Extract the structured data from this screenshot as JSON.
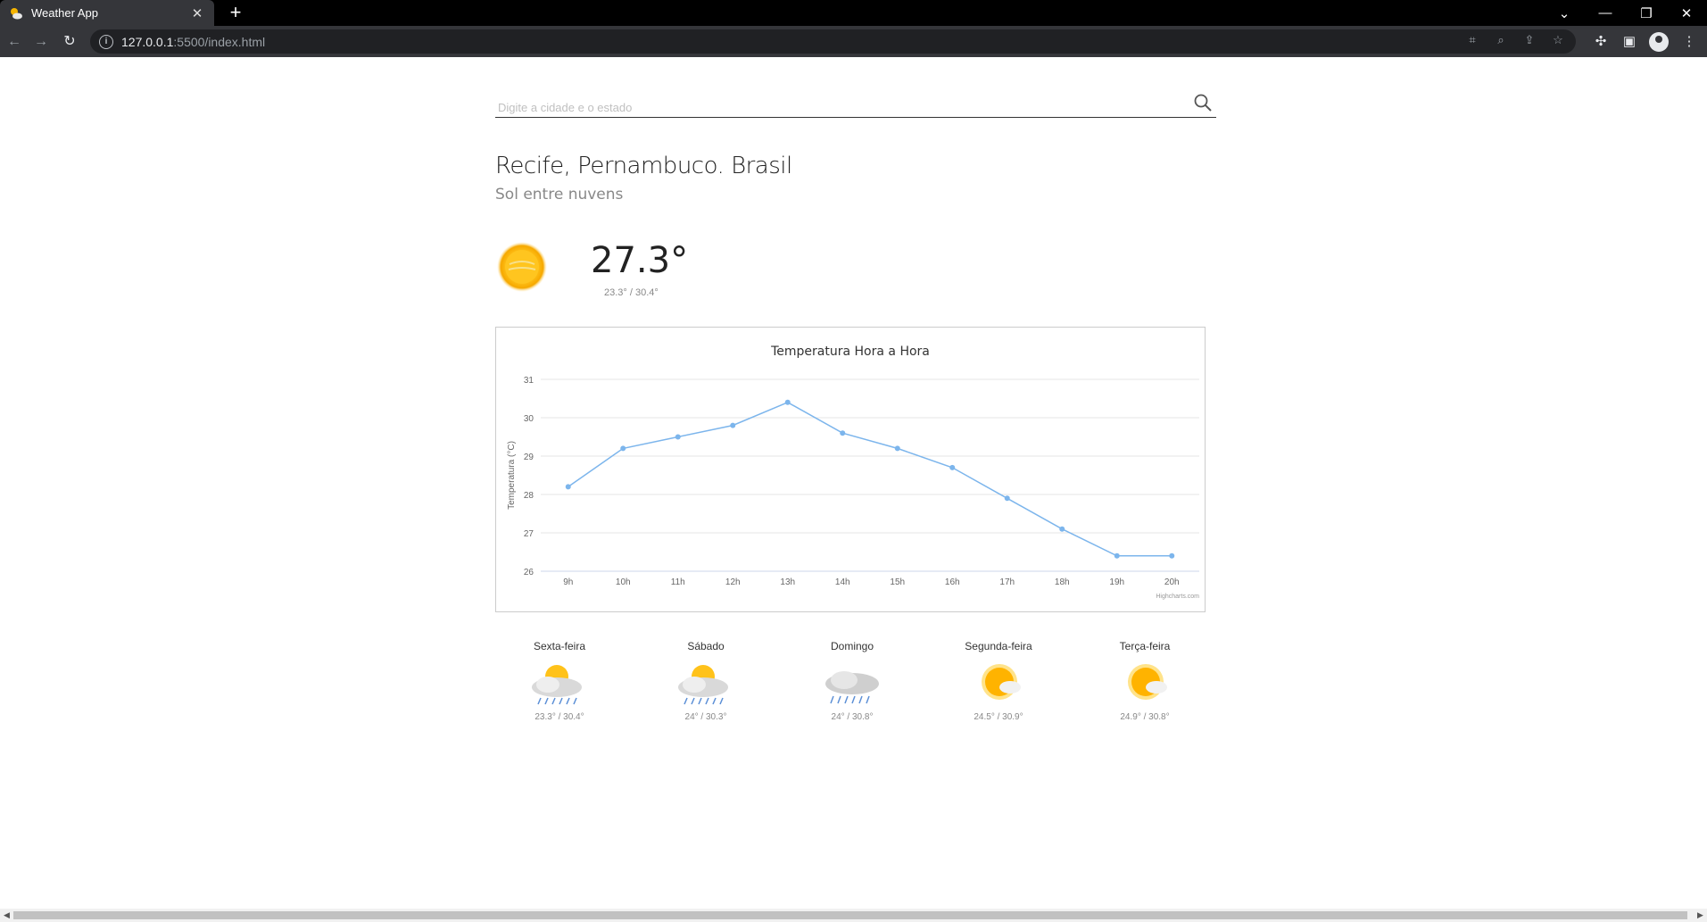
{
  "browser": {
    "tab_title": "Weather App",
    "url_host": "127.0.0.1",
    "url_rest": ":5500/index.html"
  },
  "search": {
    "placeholder": "Digite a cidade e o estado",
    "value": ""
  },
  "location": {
    "title": "Recife, Pernambuco. Brasil",
    "condition": "Sol entre nuvens"
  },
  "current": {
    "temp": "27.3°",
    "range": "23.3° / 30.4°",
    "icon": "sun-icon"
  },
  "chart_data": {
    "type": "line",
    "title": "Temperatura Hora a Hora",
    "ylabel": "Temperatura (°C)",
    "xlabel": "",
    "categories": [
      "9h",
      "10h",
      "11h",
      "12h",
      "13h",
      "14h",
      "15h",
      "16h",
      "17h",
      "18h",
      "19h",
      "20h"
    ],
    "values": [
      28.2,
      29.2,
      29.5,
      29.8,
      30.4,
      29.6,
      29.2,
      28.7,
      27.9,
      27.1,
      26.4,
      26.4
    ],
    "ylim": [
      26,
      31
    ],
    "yticks": [
      26,
      27,
      28,
      29,
      30,
      31
    ],
    "color": "#7cb5ec",
    "credit": "Highcharts.com",
    "grid": true
  },
  "forecast": [
    {
      "day": "Sexta-feira",
      "range": "23.3° / 30.4°",
      "icon": "sun-cloud-rain-icon"
    },
    {
      "day": "Sábado",
      "range": "24° / 30.3°",
      "icon": "sun-cloud-rain-icon"
    },
    {
      "day": "Domingo",
      "range": "24° / 30.8°",
      "icon": "cloud-rain-icon"
    },
    {
      "day": "Segunda-feira",
      "range": "24.5° / 30.9°",
      "icon": "sun-cloud-icon"
    },
    {
      "day": "Terça-feira",
      "range": "24.9° / 30.8°",
      "icon": "sun-cloud-icon"
    }
  ]
}
